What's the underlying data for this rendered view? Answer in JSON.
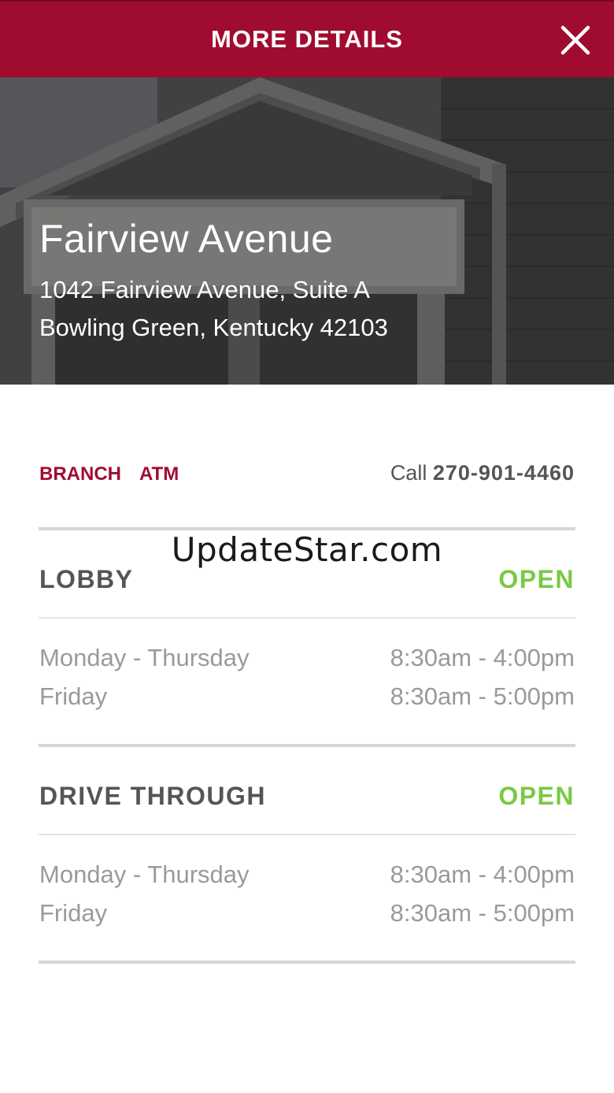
{
  "header": {
    "title": "MORE DETAILS",
    "close_icon": "close-icon"
  },
  "branch": {
    "name": "Fairview Avenue",
    "address_line1": "1042 Fairview Avenue, Suite A",
    "address_line2": "Bowling Green, Kentucky 42103"
  },
  "tabs": [
    {
      "label": "BRANCH"
    },
    {
      "label": "ATM"
    }
  ],
  "call": {
    "prefix": "Call",
    "phone": "270-901-4460"
  },
  "sections": [
    {
      "title": "LOBBY",
      "status": "OPEN",
      "hours": [
        {
          "days": "Monday - Thursday",
          "time": "8:30am - 4:00pm"
        },
        {
          "days": "Friday",
          "time": "8:30am - 5:00pm"
        }
      ]
    },
    {
      "title": "DRIVE THROUGH",
      "status": "OPEN",
      "hours": [
        {
          "days": "Monday - Thursday",
          "time": "8:30am - 4:00pm"
        },
        {
          "days": "Friday",
          "time": "8:30am - 5:00pm"
        }
      ]
    }
  ],
  "watermark": "UpdateStar.com",
  "colors": {
    "brand": "#a00c30",
    "status_open": "#7ac943",
    "text_muted": "#9a9a9a",
    "text_dark": "#555555"
  }
}
